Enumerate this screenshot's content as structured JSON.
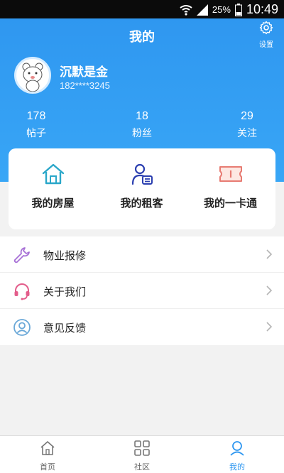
{
  "status_bar": {
    "battery": "25%",
    "time": "10:49"
  },
  "header": {
    "title": "我的",
    "settings_label": "设置"
  },
  "profile": {
    "name": "沉默是金",
    "phone": "182****3245"
  },
  "stats": [
    {
      "value": "178",
      "label": "帖子"
    },
    {
      "value": "18",
      "label": "粉丝"
    },
    {
      "value": "29",
      "label": "关注"
    }
  ],
  "shortcuts": [
    {
      "label": "我的房屋",
      "icon": "house-icon"
    },
    {
      "label": "我的租客",
      "icon": "tenant-icon"
    },
    {
      "label": "我的一卡通",
      "icon": "card-icon"
    }
  ],
  "menu": [
    {
      "label": "物业报修",
      "icon": "wrench-icon"
    },
    {
      "label": "关于我们",
      "icon": "headset-icon"
    },
    {
      "label": "意见反馈",
      "icon": "user-circle-icon"
    }
  ],
  "tabs": [
    {
      "label": "首页",
      "icon": "home-icon",
      "active": false
    },
    {
      "label": "社区",
      "icon": "grid-icon",
      "active": false
    },
    {
      "label": "我的",
      "icon": "user-icon",
      "active": true
    }
  ],
  "colors": {
    "primary": "#2f97f0",
    "background": "#f2f2f2"
  }
}
